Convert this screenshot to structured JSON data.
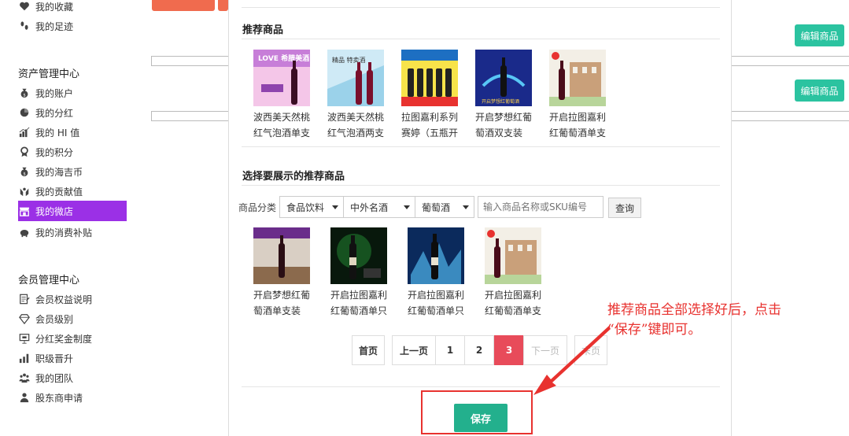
{
  "sidebar": {
    "items_top": [
      {
        "label": "我的收藏",
        "icon": "heart-icon"
      },
      {
        "label": "我的足迹",
        "icon": "footprint-icon"
      }
    ],
    "asset_center": {
      "title": "资产管理中心",
      "items": [
        {
          "label": "我的账户",
          "icon": "money-bag-icon"
        },
        {
          "label": "我的分红",
          "icon": "pie-chart-icon"
        },
        {
          "label": "我的 HI 值",
          "icon": "bar-chart-icon"
        },
        {
          "label": "我的积分",
          "icon": "medal-icon"
        },
        {
          "label": "我的海吉币",
          "icon": "coin-bag-icon"
        },
        {
          "label": "我的贡献值",
          "icon": "hands-icon"
        },
        {
          "label": "我的微店",
          "icon": "store-icon",
          "active": true
        },
        {
          "label": "我的消费补贴",
          "icon": "piggy-bank-icon"
        }
      ]
    },
    "member_center": {
      "title": "会员管理中心",
      "items": [
        {
          "label": "会员权益说明",
          "icon": "document-icon"
        },
        {
          "label": "会员级别",
          "icon": "diamond-icon"
        },
        {
          "label": "分红奖金制度",
          "icon": "presentation-icon"
        },
        {
          "label": "职级晋升",
          "icon": "rank-icon"
        },
        {
          "label": "我的团队",
          "icon": "team-icon"
        },
        {
          "label": "股东商申请",
          "icon": "person-icon"
        }
      ]
    }
  },
  "background": {
    "edit_product_label": "编辑商品"
  },
  "modal": {
    "recommended_title": "推荐商品",
    "recommended": [
      {
        "name": "波西美天然桃红气泡酒单支",
        "img_text": "LOVE 希腊美酒"
      },
      {
        "name": "波西美天然桃红气泡酒两支",
        "img_text": "精品 特卖酒"
      },
      {
        "name": "拉图嘉利系列赛婷（五瓶开",
        "img_text": ""
      },
      {
        "name": "开启梦想红葡萄酒双支装",
        "img_text": "开启梦想红葡萄酒"
      },
      {
        "name": "开启拉图嘉利红葡萄酒单支",
        "img_text": ""
      }
    ],
    "select_title": "选择要展示的推荐商品",
    "filter": {
      "label": "商品分类",
      "cat1": "食品饮料",
      "cat2": "中外名酒",
      "cat3": "葡萄酒",
      "search_placeholder": "输入商品名称或SKU编号",
      "query_label": "查询"
    },
    "candidates": [
      {
        "name": "开启梦想红葡萄酒单支装"
      },
      {
        "name": "开启拉图嘉利红葡萄酒单只"
      },
      {
        "name": "开启拉图嘉利红葡萄酒单只"
      },
      {
        "name": "开启拉图嘉利红葡萄酒单支"
      }
    ],
    "pagination": {
      "first": "首页",
      "prev": "上一页",
      "pages": [
        "1",
        "2",
        "3"
      ],
      "current": "3",
      "next": "下一页",
      "last": "末页"
    },
    "save_label": "保存"
  },
  "annotation": {
    "line1": "推荐商品全部选择好后，点击",
    "line2": "“保存”键即可。"
  },
  "colors": {
    "accent_purple": "#9b30e6",
    "save_green": "#23b08d",
    "edit_green": "#2bc3a0",
    "page_active": "#e84b5a",
    "annotation_red": "#e8322f"
  }
}
